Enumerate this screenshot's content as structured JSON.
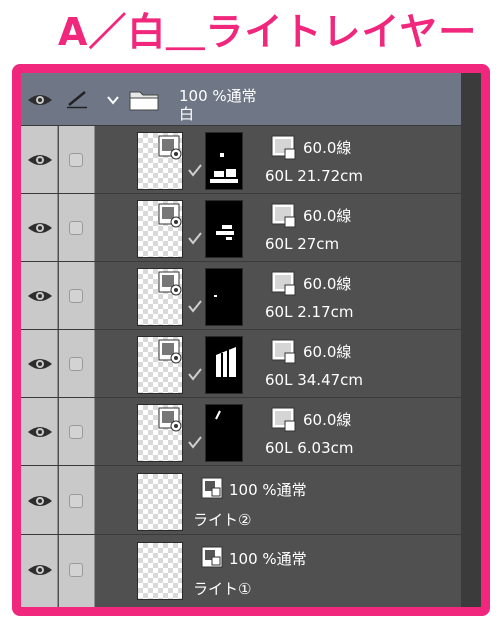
{
  "heading": "A／白＿ライトレイヤー",
  "folder": {
    "blend": "100 %通常",
    "name": "白"
  },
  "tone_layers": [
    {
      "blend": "60.0線",
      "info": "60L 21.72cm"
    },
    {
      "blend": "60.0線",
      "info": "60L 27cm"
    },
    {
      "blend": "60.0線",
      "info": "60L 2.17cm"
    },
    {
      "blend": "60.0線",
      "info": "60L 34.47cm"
    },
    {
      "blend": "60.0線",
      "info": "60L 6.03cm"
    }
  ],
  "raster_layers": [
    {
      "blend": "100 %通常",
      "name": "ライト②"
    },
    {
      "blend": "100 %通常",
      "name": "ライト①"
    }
  ],
  "icons": {
    "eye": "eye-icon",
    "pen": "pen-icon",
    "folder": "folder-icon",
    "chevron": "chevron-down-icon",
    "mask": "layer-mask-thumbnail",
    "tone": "tone-icon",
    "raster": "raster-layer-icon"
  },
  "colors": {
    "frame": "#f0277d",
    "panel": "#505050",
    "folder_row": "#6f7787",
    "left_columns": "#c9c9c9"
  }
}
